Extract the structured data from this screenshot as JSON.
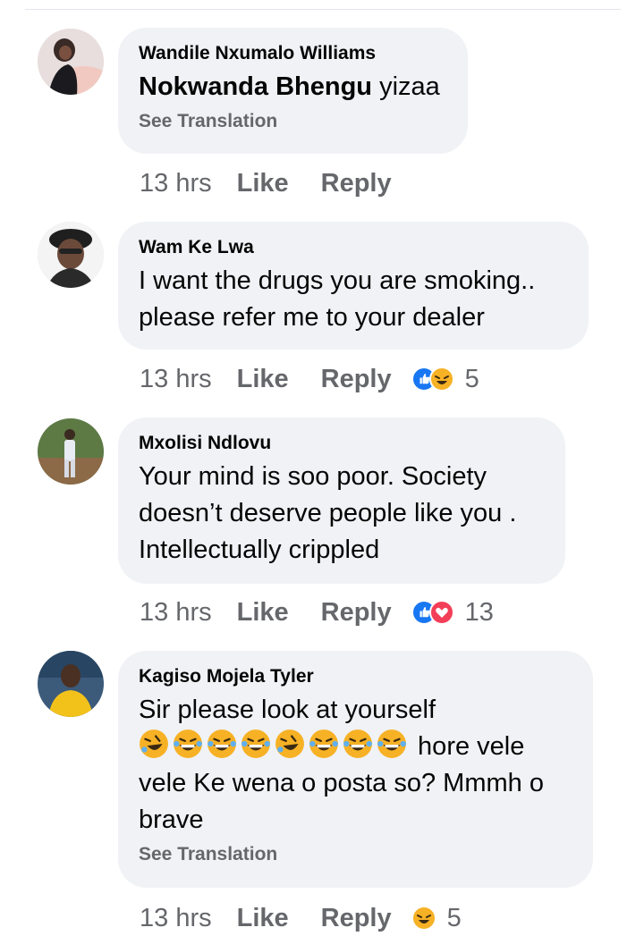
{
  "comments": [
    {
      "author": "Wandile Nxumalo Williams",
      "mention": "Nokwanda Bhengu",
      "text": " yizaa",
      "see_translation": "See Translation",
      "time": "13 hrs",
      "like": "Like",
      "reply": "Reply",
      "reaction_count": ""
    },
    {
      "author": "Wam Ke Lwa",
      "text_lines": [
        "I want the drugs you are smoking..",
        "please refer me to your dealer"
      ],
      "time": "13 hrs",
      "like": "Like",
      "reply": "Reply",
      "reactions": [
        "like-reaction-icon",
        "haha-reaction-icon"
      ],
      "reaction_count": "5"
    },
    {
      "author": "Mxolisi Ndlovu",
      "text_lines": [
        "Your mind is soo poor. Society",
        "doesn’t deserve people like you .",
        "Intellectually crippled"
      ],
      "time": "13 hrs",
      "like": "Like",
      "reply": "Reply",
      "reactions": [
        "like-reaction-icon",
        "love-reaction-icon"
      ],
      "reaction_count": "13"
    },
    {
      "author": "Kagiso Mojela Tyler",
      "text_line1": "Sir please look at yourself",
      "text_after_emoji": " hore vele",
      "text_lines_rest": [
        "vele Ke wena o posta so? Mmmh o",
        "brave"
      ],
      "see_translation": "See Translation",
      "time": "13 hrs",
      "like": "Like",
      "reply": "Reply",
      "reactions": [
        "haha-reaction-icon"
      ],
      "reaction_count": "5"
    }
  ],
  "colors": {
    "bubble": "#f0f2f5",
    "secondary_text": "#65676b",
    "like_blue": "#1877f2",
    "love_red": "#f33e58",
    "haha_yellow": "#f7b125"
  }
}
